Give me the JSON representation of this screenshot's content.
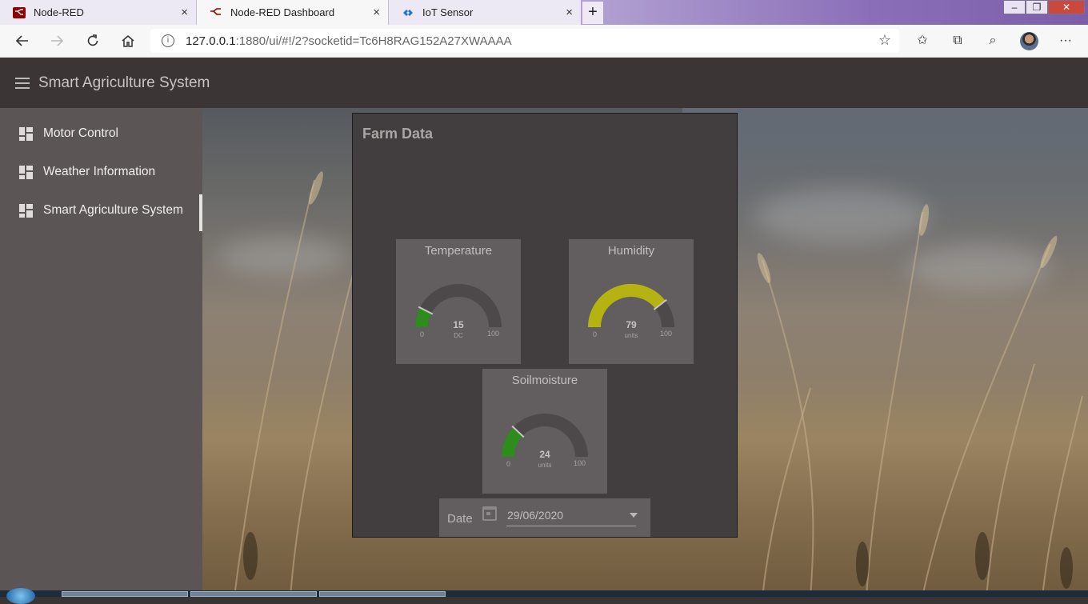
{
  "browser": {
    "tabs": [
      {
        "title": "Node-RED",
        "icon": "node-red-icon",
        "active": false
      },
      {
        "title": "Node-RED Dashboard",
        "icon": "node-red-dashboard-icon",
        "active": true
      },
      {
        "title": "IoT Sensor",
        "icon": "iot-sensor-icon",
        "active": false
      }
    ],
    "close_glyph": "×",
    "new_tab_glyph": "+",
    "url_host": "127.0.0.1",
    "url_rest": ":1880/ui/#!/2?socketid=Tc6H8RAG152A27XWAAAA"
  },
  "app": {
    "title": "Smart Agriculture System"
  },
  "sidebar": {
    "items": [
      {
        "label": "Motor Control",
        "selected": false
      },
      {
        "label": "Weather Information",
        "selected": false
      },
      {
        "label": "Smart Agriculture System",
        "selected": true
      }
    ]
  },
  "card": {
    "title": "Farm Data",
    "gauges": [
      {
        "title": "Temperature",
        "value": 15,
        "unit": "DC",
        "min": 0,
        "max": 100,
        "color": "#2e8b1e"
      },
      {
        "title": "Humidity",
        "value": 79,
        "unit": "units",
        "min": 0,
        "max": 100,
        "color": "#b5b312"
      },
      {
        "title": "Soilmoisture",
        "value": 24,
        "unit": "units",
        "min": 0,
        "max": 100,
        "color": "#2e8b1e"
      }
    ],
    "date": {
      "label": "Date",
      "value": "29/06/2020"
    }
  },
  "colors": {
    "header_bg": "#3b3535",
    "sidebar_bg": "#5b5556",
    "card_bg": "#423d3e",
    "gauge_track": "#4d4849"
  }
}
